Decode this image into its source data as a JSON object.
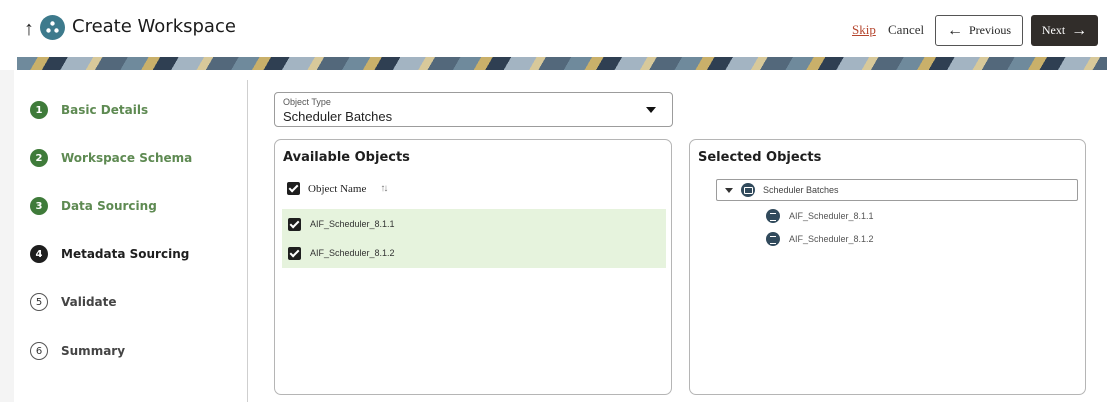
{
  "header": {
    "title": "Create Workspace",
    "skip_label": "Skip",
    "cancel_label": "Cancel",
    "previous_label": "Previous",
    "next_label": "Next"
  },
  "steps": [
    {
      "number": "1",
      "label": "Basic Details",
      "state": "done"
    },
    {
      "number": "2",
      "label": "Workspace Schema",
      "state": "done"
    },
    {
      "number": "3",
      "label": "Data Sourcing",
      "state": "done"
    },
    {
      "number": "4",
      "label": "Metadata Sourcing",
      "state": "current"
    },
    {
      "number": "5",
      "label": "Validate",
      "state": "future"
    },
    {
      "number": "6",
      "label": "Summary",
      "state": "future"
    }
  ],
  "object_type": {
    "label": "Object Type",
    "value": "Scheduler Batches"
  },
  "available": {
    "title": "Available Objects",
    "column_header": "Object Name",
    "rows": [
      {
        "name": "AIF_Scheduler_8.1.1",
        "checked": true
      },
      {
        "name": "AIF_Scheduler_8.1.2",
        "checked": true
      }
    ]
  },
  "selected": {
    "title": "Selected Objects",
    "root": "Scheduler Batches",
    "children": [
      "AIF_Scheduler_8.1.1",
      "AIF_Scheduler_8.1.2"
    ]
  },
  "colors": {
    "step_done": "#3f7b3a",
    "step_current": "#1e1e1e",
    "row_highlight": "#e6f3dd",
    "next_button": "#312d2a",
    "skip_link": "#b5452d"
  }
}
